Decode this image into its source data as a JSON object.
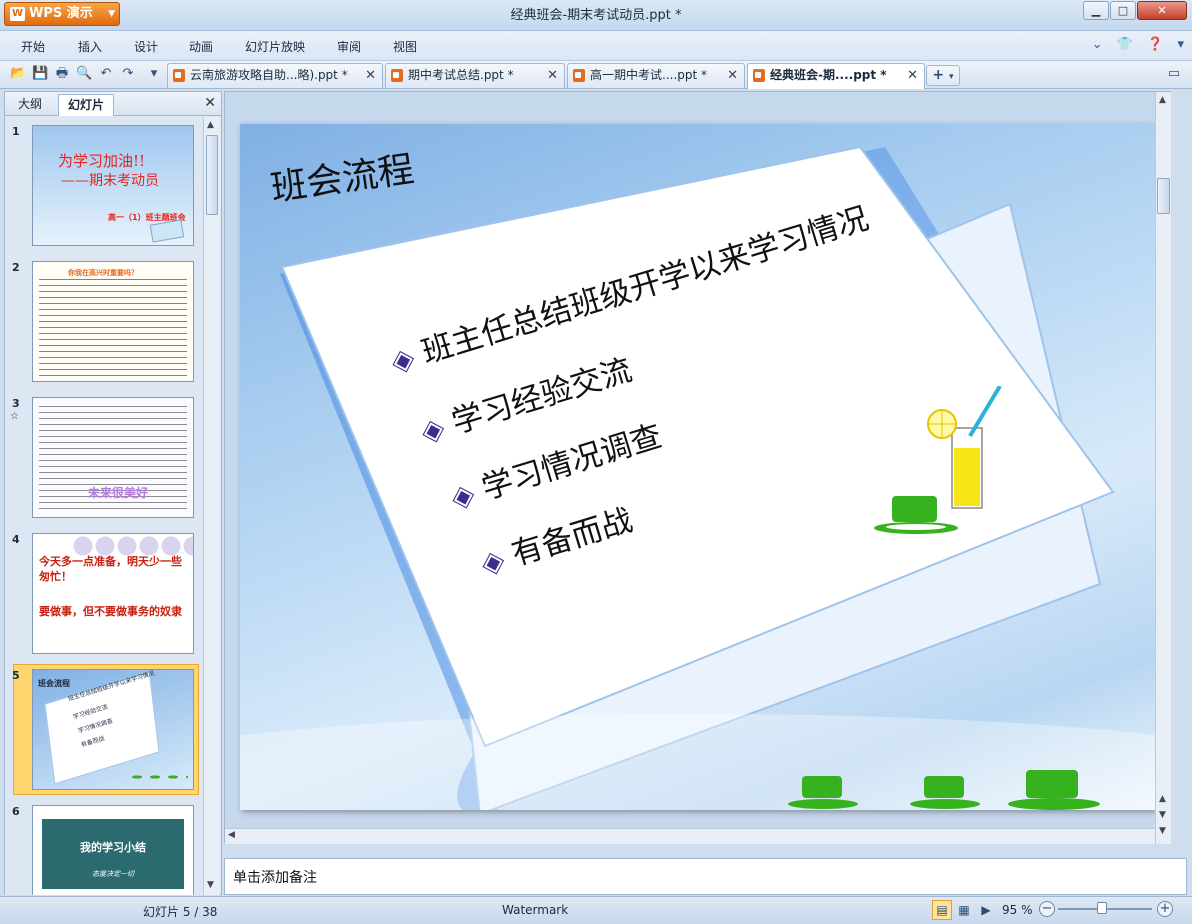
{
  "window": {
    "app_button": "WPS 演示",
    "title": "经典班会-期末考试动员.ppt *"
  },
  "menu": {
    "items": [
      "开始",
      "插入",
      "设计",
      "动画",
      "幻灯片放映",
      "审阅",
      "视图"
    ]
  },
  "tabs": [
    {
      "label": "云南旅游攻略自助...略).ppt *",
      "active": false
    },
    {
      "label": "期中考试总结.ppt *",
      "active": false
    },
    {
      "label": "高一期中考试....ppt *",
      "active": false
    },
    {
      "label": "经典班会-期....ppt *",
      "active": true
    }
  ],
  "left_pane": {
    "tab_outline": "大纲",
    "tab_slides": "幻灯片",
    "thumbnails": [
      {
        "num": "1",
        "title": "为学习加油!!",
        "subtitle": "——期末考动员",
        "footer": "高一（1）班主题班会"
      },
      {
        "num": "2",
        "title": "你我在高兴时重要吗？"
      },
      {
        "num": "3",
        "title": "未来很美好"
      },
      {
        "num": "4",
        "line1": "今天多一点准备，明天少一些匆忙！",
        "line2": "要做事，但不要做事务的奴隶"
      },
      {
        "num": "5",
        "title": "班会流程",
        "items": [
          "班主任总结班级开学以来学习情况",
          "学习经验交流",
          "学习情况调查",
          "有备而战"
        ]
      },
      {
        "num": "6",
        "title": "我的学习小结",
        "subtitle": "态度决定一切"
      }
    ]
  },
  "slide": {
    "title": "班会流程",
    "bullets": [
      "班主任总结班级开学以来学习情况",
      "学习经验交流",
      "学习情况调查",
      "有备而战"
    ]
  },
  "notes": {
    "placeholder": "单击添加备注"
  },
  "status": {
    "slide_counter": "幻灯片 5 / 38",
    "watermark": "Watermark",
    "zoom": "95 %"
  }
}
